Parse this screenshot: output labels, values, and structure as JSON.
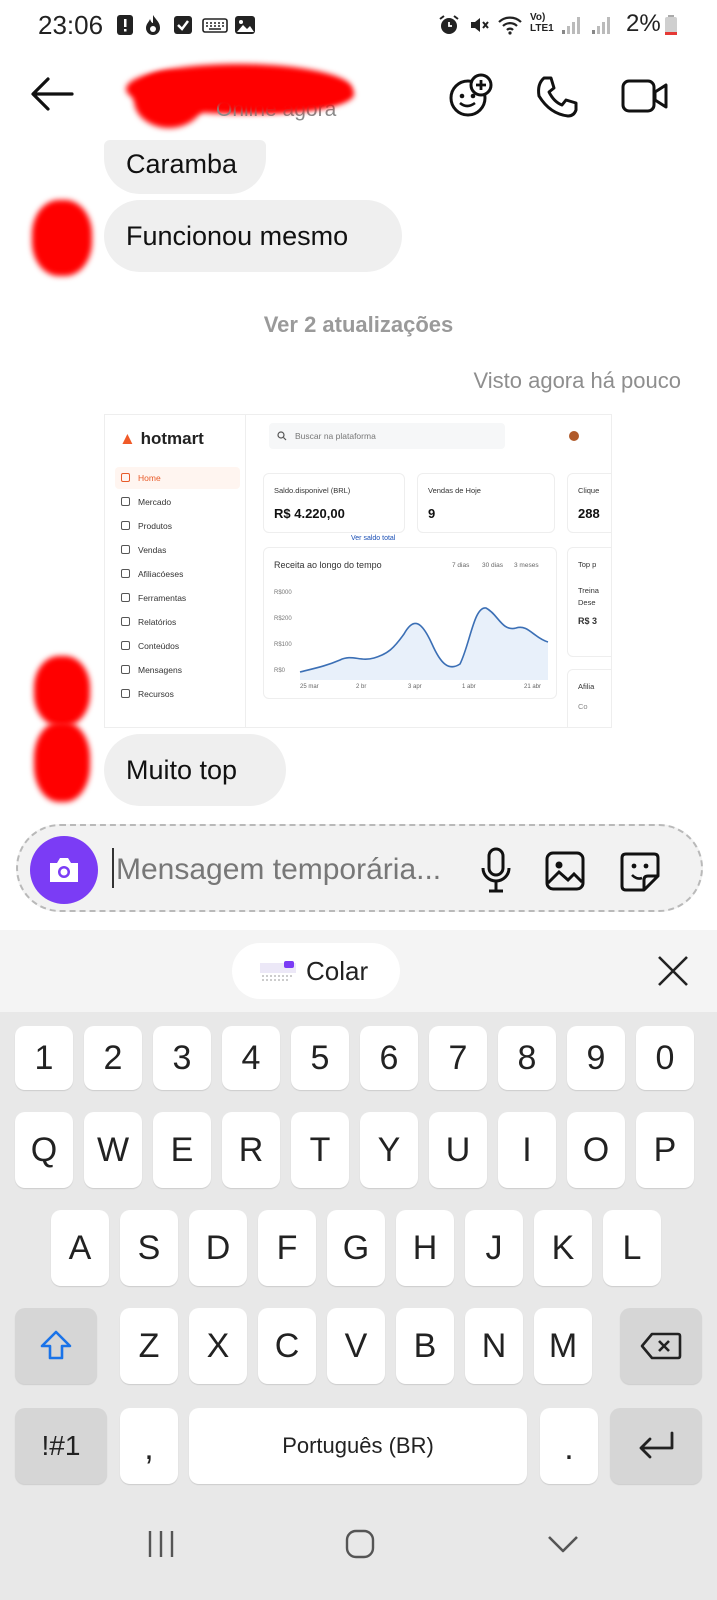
{
  "status_bar": {
    "time": "23:06",
    "network_label_top": "Vo)",
    "network_label_bottom": "LTE1",
    "battery": "2%"
  },
  "header": {
    "contact_status": "Online agora",
    "icons": [
      "back-arrow-icon",
      "add-effects-icon",
      "phone-icon",
      "video-icon"
    ]
  },
  "messages": [
    {
      "text": "Caramba"
    },
    {
      "text": "Funcionou mesmo"
    },
    {
      "text": "Muito top"
    }
  ],
  "updates_link": "Ver 2 atualizações",
  "seen": "Visto agora há pouco",
  "shared_image": {
    "logo": "hotmart",
    "search_placeholder": "Buscar na plataforma",
    "nav": [
      "Home",
      "Mercado",
      "Produtos",
      "Vendas",
      "Afiliacóeses",
      "Ferramentas",
      "Relatórios",
      "Conteúdos",
      "Mensagens",
      "Recursos"
    ],
    "balance_label": "Saldo.disponivel (BRL)",
    "balance_value": "R$ 4.220,00",
    "balance_link": "Ver saldo total",
    "sales_label": "Vendas de Hoje",
    "sales_value": "9",
    "clicks_label": "Clique",
    "clicks_value": "288",
    "chart_title": "Receita ao longo do tempo",
    "ranges": [
      "7 dias",
      "30 dias",
      "3 meses"
    ],
    "y_ticks": [
      "R$000",
      "R$200",
      "R$100",
      "R$0"
    ],
    "x_ticks": [
      "25 mar",
      "2 br",
      "3 apr",
      "1 abr",
      "21 abr"
    ],
    "top_label": "Top p",
    "top_item_1": "Treina",
    "top_item_2": "Dese",
    "top_value": "R$ 3",
    "afil_label": "Afilia",
    "afil_sub": "Co"
  },
  "composer": {
    "placeholder": "Mensagem temporária..."
  },
  "clipboard": {
    "paste_label": "Colar"
  },
  "keyboard": {
    "row_numbers": [
      "1",
      "2",
      "3",
      "4",
      "5",
      "6",
      "7",
      "8",
      "9",
      "0"
    ],
    "row_top": [
      "Q",
      "W",
      "E",
      "R",
      "T",
      "Y",
      "U",
      "I",
      "O",
      "P"
    ],
    "row_middle": [
      "A",
      "S",
      "D",
      "F",
      "G",
      "H",
      "J",
      "K",
      "L"
    ],
    "row_bottom": [
      "Z",
      "X",
      "C",
      "V",
      "B",
      "N",
      "M"
    ],
    "symbols_label": "!#1",
    "comma_label": ",",
    "space_label": "Português (BR)",
    "period_label": "."
  }
}
